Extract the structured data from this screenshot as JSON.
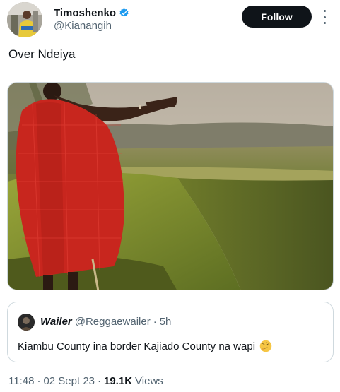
{
  "author": {
    "name": "Timoshenko",
    "handle": "@Kianangih",
    "verified": true,
    "verified_color": "#1d9bf0"
  },
  "actions": {
    "follow_label": "Follow",
    "more_icon": "more-vertical-icon"
  },
  "tweet": {
    "text": "Over Ndeiya"
  },
  "quote": {
    "name": "Wailer",
    "handle": "@Reggaewailer",
    "separator": "·",
    "time": "5h",
    "text": "Kiambu County ina border Kajiado County na wapi",
    "emoji": "thinking-face-emoji"
  },
  "meta": {
    "time": "11:48",
    "sep1": "·",
    "date": "02 Sept 23",
    "sep2": "·",
    "views_count": "19.1K",
    "views_label": "Views"
  },
  "colors": {
    "text_primary": "#0f1419",
    "text_secondary": "#536471",
    "border": "#cfd9de",
    "follow_bg": "#0f1419"
  }
}
